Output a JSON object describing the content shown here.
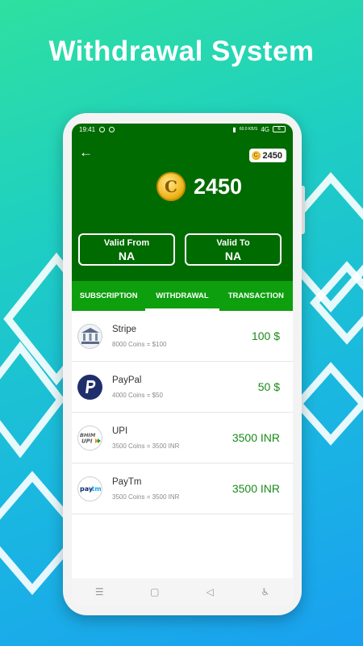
{
  "headline": "Withdrawal System",
  "status_bar": {
    "time": "19:41",
    "network": "60.0 KB/S",
    "signal": "4G",
    "battery": "6"
  },
  "header": {
    "coin_pill_value": "2450",
    "coin_symbol": "C",
    "coin_balance": "2450",
    "valid_from_label": "Valid From",
    "valid_from_value": "NA",
    "valid_to_label": "Valid To",
    "valid_to_value": "NA"
  },
  "tabs": [
    {
      "label": "SUBSCRIPTION",
      "active": false
    },
    {
      "label": "WITHDRAWAL",
      "active": true
    },
    {
      "label": "TRANSACTION",
      "active": false
    }
  ],
  "methods": [
    {
      "name": "Stripe",
      "rate": "8000 Coins = $100",
      "amount": "100 $",
      "logo_text": "BANK"
    },
    {
      "name": "PayPal",
      "rate": "4000 Coins = $50",
      "amount": "50 $",
      "logo_text": "P"
    },
    {
      "name": "UPI",
      "rate": "3500 Coins = 3500 INR",
      "amount": "3500 INR",
      "logo_text": "BHIM UPI"
    },
    {
      "name": "PayTm",
      "rate": "3500 Coins = 3500 INR",
      "amount": "3500 INR",
      "logo_text": "paytm"
    }
  ],
  "nav": {
    "recents_icon": "☰",
    "home_icon": "▢",
    "back_icon": "◁",
    "accessibility_icon": "♿"
  },
  "colors": {
    "header_green": "#006b00",
    "tab_green": "#0e9f0e",
    "amount_green": "#1a8a1a"
  }
}
